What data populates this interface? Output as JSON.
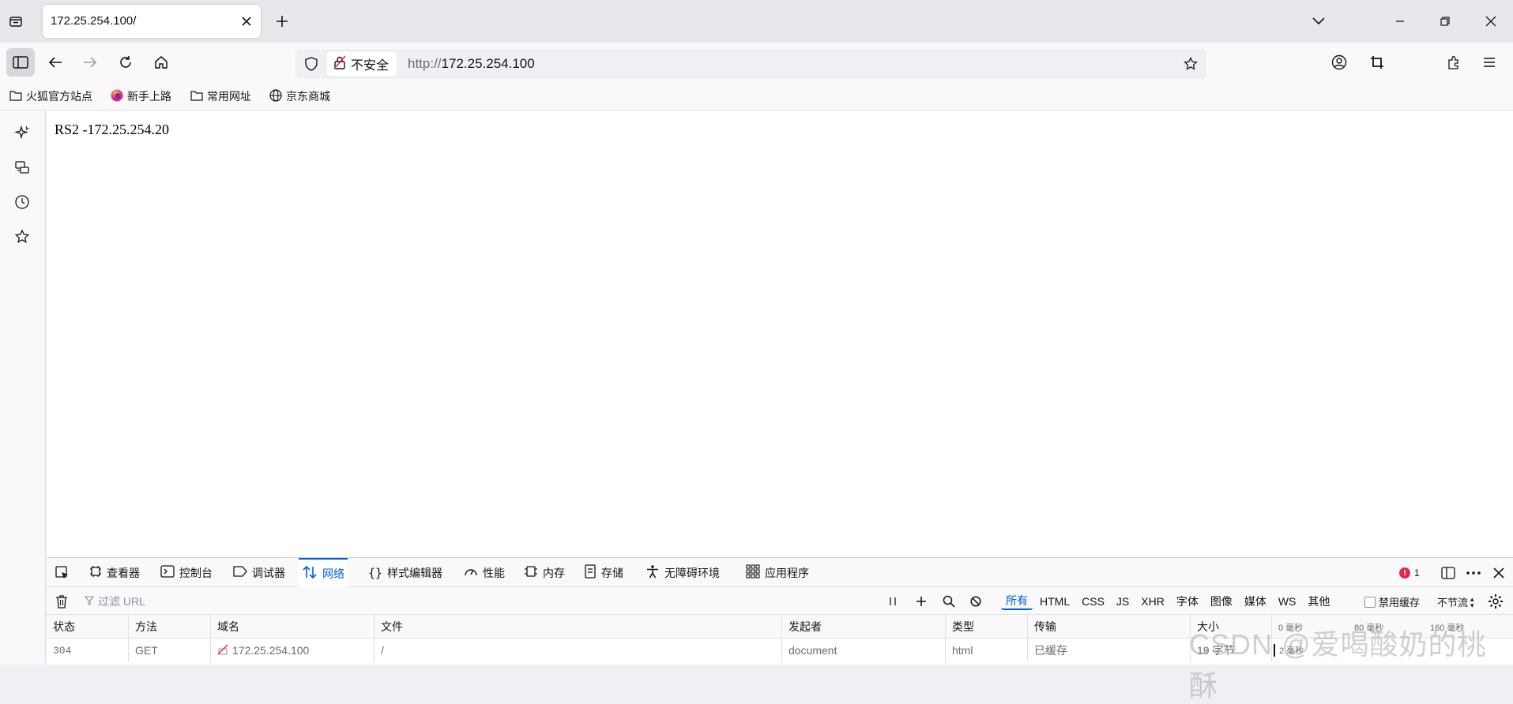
{
  "tab": {
    "title": "172.25.254.100/"
  },
  "navbar": {
    "security_label": "不安全",
    "url_protocol": "http://",
    "url_host": "172.25.254.100"
  },
  "bookmarks": [
    {
      "label": "火狐官方站点",
      "icon": "folder-icon"
    },
    {
      "label": "新手上路",
      "icon": "firefox-icon"
    },
    {
      "label": "常用网址",
      "icon": "folder-icon"
    },
    {
      "label": "京东商城",
      "icon": "globe-icon"
    }
  ],
  "page": {
    "text": "RS2 -172.25.254.20"
  },
  "devtools": {
    "tabs": [
      {
        "label": "查看器",
        "icon": "inspector-icon"
      },
      {
        "label": "控制台",
        "icon": "console-icon"
      },
      {
        "label": "调试器",
        "icon": "debugger-icon"
      },
      {
        "label": "网络",
        "icon": "network-icon",
        "active": true
      },
      {
        "label": "样式编辑器",
        "icon": "style-editor-icon"
      },
      {
        "label": "性能",
        "icon": "performance-icon"
      },
      {
        "label": "内存",
        "icon": "memory-icon"
      },
      {
        "label": "存储",
        "icon": "storage-icon"
      },
      {
        "label": "无障碍环境",
        "icon": "accessibility-icon"
      },
      {
        "label": "应用程序",
        "icon": "application-icon"
      }
    ],
    "error_count": "1",
    "filter_placeholder": "过滤 URL",
    "type_filters": [
      "所有",
      "HTML",
      "CSS",
      "JS",
      "XHR",
      "字体",
      "图像",
      "媒体",
      "WS",
      "其他"
    ],
    "disable_cache_label": "禁用缓存",
    "throttle_label": "不节流",
    "columns": [
      "状态",
      "方法",
      "域名",
      "文件",
      "发起者",
      "类型",
      "传输",
      "大小"
    ],
    "waterfall_labels": [
      "0 毫秒",
      "80 毫秒",
      "160 毫秒"
    ],
    "rows": [
      {
        "status": "304",
        "method": "GET",
        "domain": "172.25.254.100",
        "file": "/",
        "initiator": "document",
        "type": "html",
        "transferred": "已缓存",
        "size": "19 字节",
        "timing": "2 毫秒"
      }
    ]
  },
  "watermark": "CSDN @爱喝酸奶的桃酥",
  "colors": {
    "accent": "#0061e0",
    "error": "#e22850",
    "insecure_icon": "#e22850"
  }
}
